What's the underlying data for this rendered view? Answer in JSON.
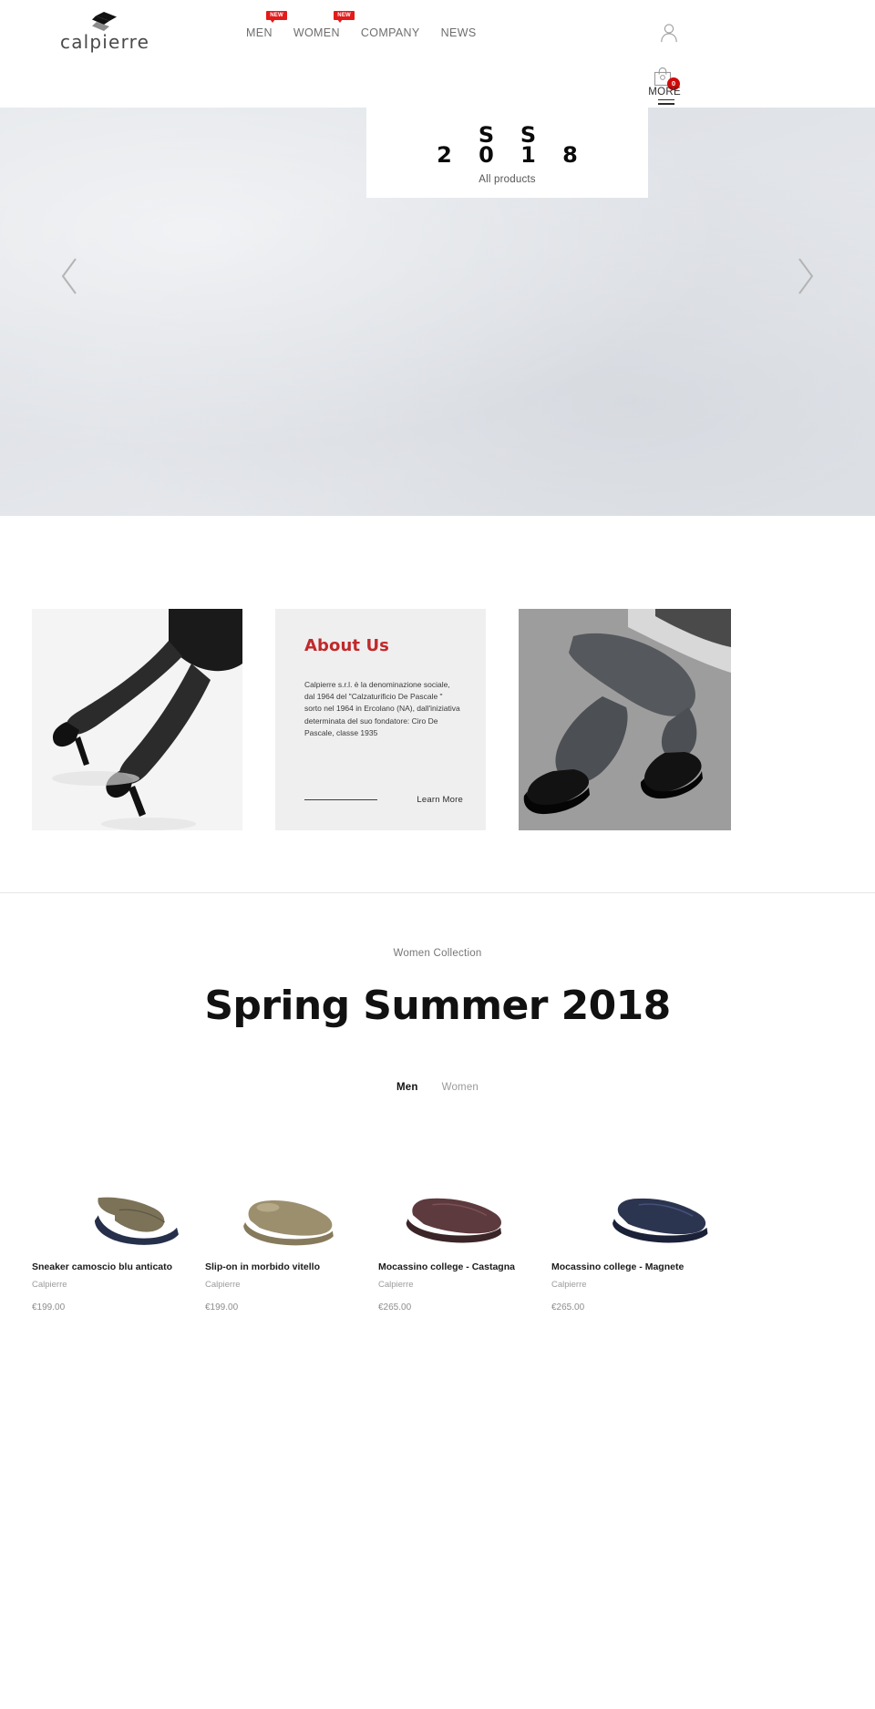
{
  "header": {
    "brand": "calpierre",
    "logo_icon": "calpierre-diamond-logo",
    "nav": [
      {
        "label": "MEN",
        "badge": "NEW"
      },
      {
        "label": "WOMEN",
        "badge": "NEW"
      },
      {
        "label": "COMPANY",
        "badge": ""
      },
      {
        "label": "NEWS",
        "badge": ""
      }
    ],
    "account_icon": "user-account-icon",
    "cart_icon": "shopping-bag-icon",
    "cart_count": "0",
    "more_label": "MORE",
    "menu_icon": "hamburger-menu-icon"
  },
  "hero": {
    "letters": [
      "2",
      "S",
      "S",
      "",
      "",
      "0",
      "1",
      "8"
    ],
    "grid_top": [
      "",
      "S",
      "S",
      ""
    ],
    "grid_bottom": [
      "2",
      "0",
      "1",
      "8"
    ],
    "subtitle": "All products",
    "prev_icon": "chevron-left-icon",
    "next_icon": "chevron-right-icon"
  },
  "about": {
    "left_image_alt": "woman-legs-black-heels-photo",
    "right_image_alt": "man-seated-black-derby-shoes-photo",
    "title": "About Us",
    "title_color": "#c0292b",
    "body": "Calpierre s.r.l. è la denominazione sociale, dal 1964 del \"Calzaturificio De Pascale \" sorto nel 1964 in Ercolano (NA), dall'iniziativa determinata del suo fondatore: Ciro De Pascale, classe 1935",
    "learn_more": "Learn More"
  },
  "collection": {
    "eyebrow": "Women Collection",
    "title": "Spring Summer 2018",
    "tabs": [
      {
        "label": "Men",
        "active": true
      },
      {
        "label": "Women",
        "active": false
      }
    ],
    "products": [
      {
        "name": "Sneaker camoscio blu anticato",
        "vendor": "Calpierre",
        "price": "€199.00",
        "image_alt": "blue-suede-sneaker"
      },
      {
        "name": "Slip-on in morbido vitello",
        "vendor": "Calpierre",
        "price": "€199.00",
        "image_alt": "beige-calf-slip-on"
      },
      {
        "name": "Mocassino college - Castagna",
        "vendor": "Calpierre",
        "price": "€265.00",
        "image_alt": "burgundy-college-loafer"
      },
      {
        "name": "Mocassino college - Magnete",
        "vendor": "Calpierre",
        "price": "€265.00",
        "image_alt": "navy-college-loafer"
      }
    ]
  },
  "colors": {
    "accent_red": "#c0292b",
    "badge_red": "#e21b1b",
    "cart_badge_red": "#cf0a0a",
    "panel_gray": "#efefef",
    "hero_gray": "#e3e6ea"
  }
}
